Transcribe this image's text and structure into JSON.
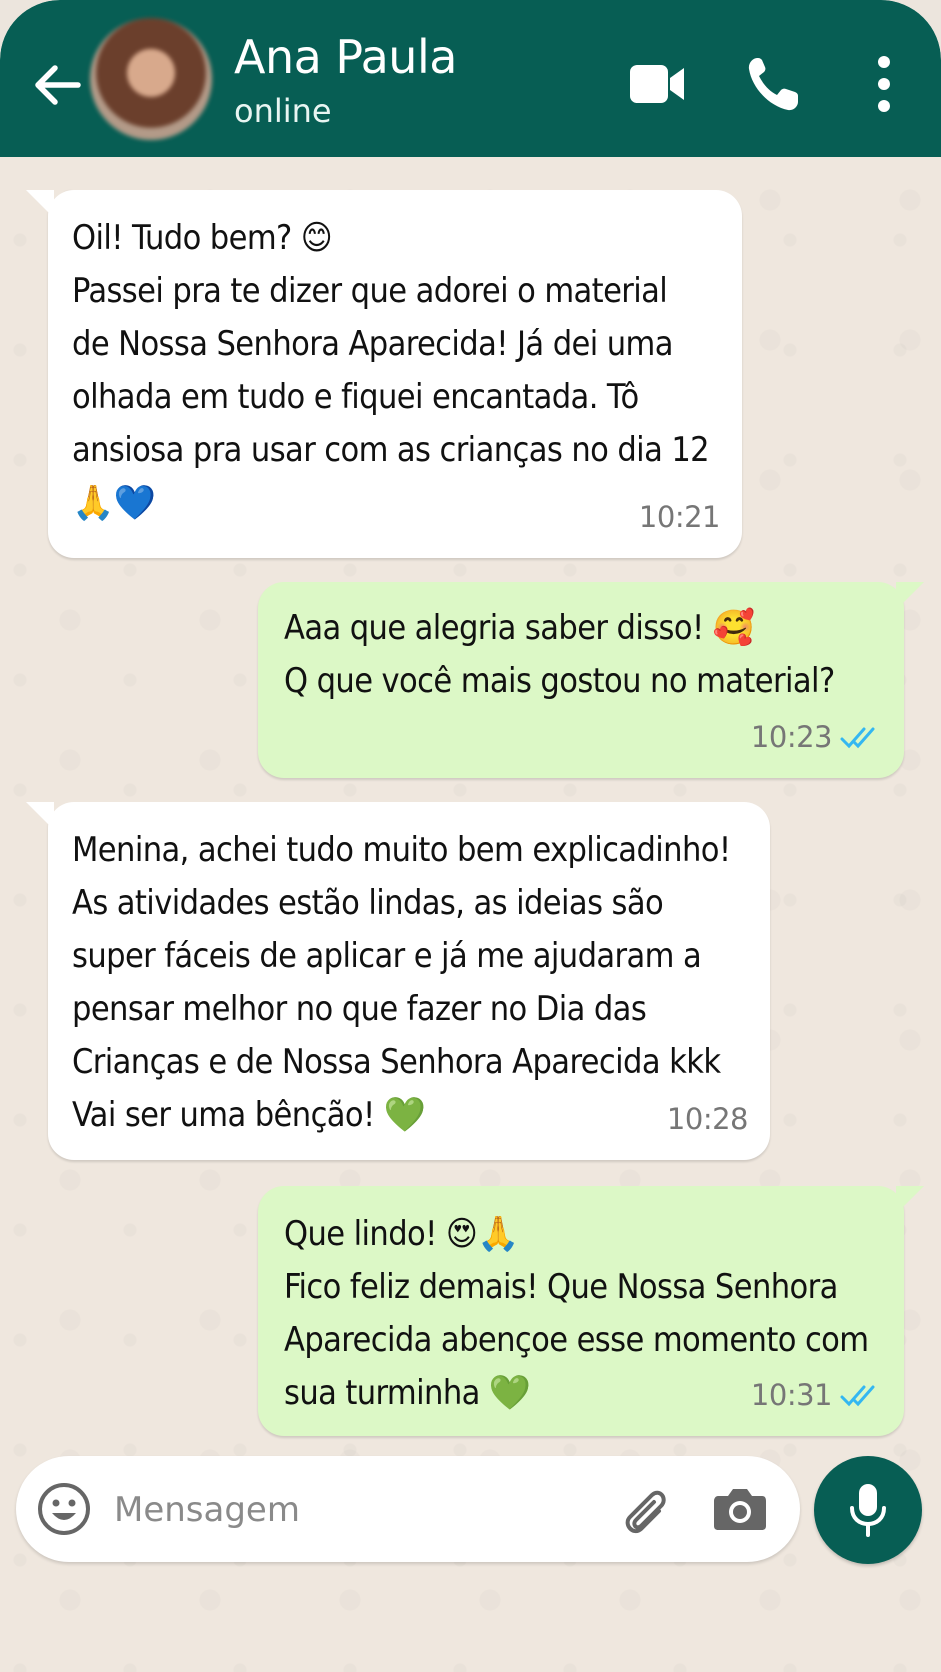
{
  "header": {
    "contact_name": "Ana Paula",
    "status": "online",
    "color": "#075e54"
  },
  "messages": [
    {
      "direction": "incoming",
      "text": "Oil! Tudo bem? 😊\nPassei pra te dizer que adorei o material\nde Nossa Senhora Aparecida! Já dei uma\nolhada em tudo e fiquei encantada. Tô\nansiosa pra usar com as crianças no dia 12\n🙏💙",
      "time": "10:21"
    },
    {
      "direction": "outgoing",
      "text": "Aaa que alegria saber disso! 🥰\nQ que você mais gostou no material?",
      "time": "10:23",
      "status": "read"
    },
    {
      "direction": "incoming",
      "text": "Menina, achei tudo muito bem explicadinho!\nAs atividades estão lindas, as ideias são\nsuper fáceis de aplicar e já me ajudaram a\npensar melhor no que fazer no Dia das\nCrianças e de Nossa Senhora Aparecida kkk\nVai ser uma bênção! 💚",
      "time": "10:28"
    },
    {
      "direction": "outgoing",
      "text": "Que lindo! 😍🙏\nFico feliz demais! Que Nossa Senhora\nAparecida abençoe esse momento com\nsua turminha 💚",
      "time": "10:31",
      "status": "read"
    }
  ],
  "composer": {
    "placeholder": "Mensagem"
  },
  "colors": {
    "incoming_bubble": "#ffffff",
    "outgoing_bubble": "#dcf8c6",
    "read_ticks": "#34b7f1",
    "mic_button": "#075e54"
  }
}
